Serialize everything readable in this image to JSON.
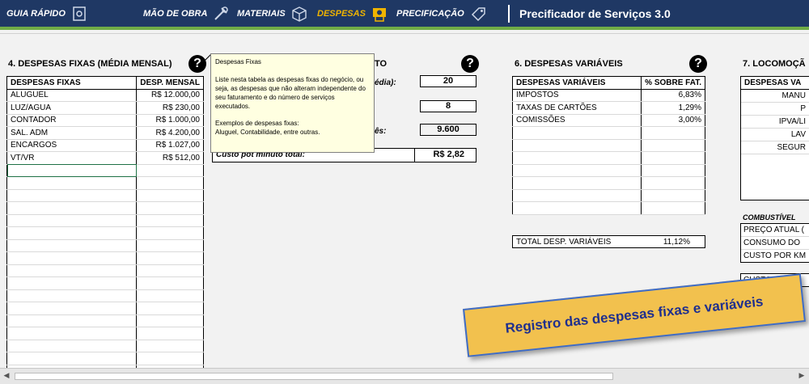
{
  "nav": {
    "items": [
      {
        "label": "GUIA RÁPIDO"
      },
      {
        "label": "MÃO DE OBRA"
      },
      {
        "label": "MATERIAIS"
      },
      {
        "label": "DESPESAS"
      },
      {
        "label": "PRECIFICAÇÃO"
      }
    ],
    "app_title": "Precificador de Serviços 3.0",
    "active_color": "#f0b400",
    "bar_color": "#1f3864",
    "accent_green": "#70ad47"
  },
  "fixed": {
    "title": "4. DESPESAS FIXAS (MÉDIA MENSAL)",
    "col1": "DESPESAS FIXAS",
    "col2": "DESP. MENSAL",
    "rows": [
      {
        "name": "ALUGUEL",
        "value": "R$ 12.000,00"
      },
      {
        "name": "LUZ/AGUA",
        "value": "R$ 230,00"
      },
      {
        "name": "CONTADOR",
        "value": "R$ 1.000,00"
      },
      {
        "name": "SAL. ADM",
        "value": "R$ 4.200,00"
      },
      {
        "name": "ENCARGOS",
        "value": "R$ 1.027,00"
      },
      {
        "name": "VT/VR",
        "value": "R$ 512,00"
      }
    ]
  },
  "tooltip": {
    "title": "Despesas Fixas",
    "p1": "Liste nesta tabela as despesas fixas do negócio, ou seja, as despesas que não alteram independente do seu faturamento e do número de serviços executados.",
    "p2a": "Exemplos de despesas fixas:",
    "p2b": "Aluguel, Contabilidade, entre outras."
  },
  "section5": {
    "title_frag": "TO",
    "label1_frag": "édia):",
    "value1": "20",
    "value2": "8",
    "label3_frag": "ês:",
    "value3": "9.600",
    "total_label": "Custo pot minuto total:",
    "total_value": "R$ 2,82"
  },
  "variable": {
    "title": "6. DESPESAS VARIÁVEIS",
    "col1": "DESPESAS VARIÁVEIS",
    "col2": "% SOBRE FAT.",
    "rows": [
      {
        "name": "IMPOSTOS",
        "value": "6,83%"
      },
      {
        "name": "TAXAS DE CARTÕES",
        "value": "1,29%"
      },
      {
        "name": "COMISSÕES",
        "value": "3,00%"
      }
    ],
    "total_label": "TOTAL DESP. VARIÁVEIS",
    "total_value": "11,12%"
  },
  "loco": {
    "title": "7. LOCOMOÇÃ",
    "col1": "DESPESAS VA",
    "rows": [
      "MANU",
      "P",
      "IPVA/LI",
      "LAV",
      "SEGUR"
    ],
    "fuel_title": "COMBUSTÍVEL",
    "fuel_rows": [
      "PREÇO ATUAL (",
      "CONSUMO DO",
      "CUSTO POR KM"
    ],
    "cost_label": "CUSTO TO"
  },
  "banner": {
    "text": "Registro das despesas fixas e variáveis"
  },
  "help_glyph": "?"
}
